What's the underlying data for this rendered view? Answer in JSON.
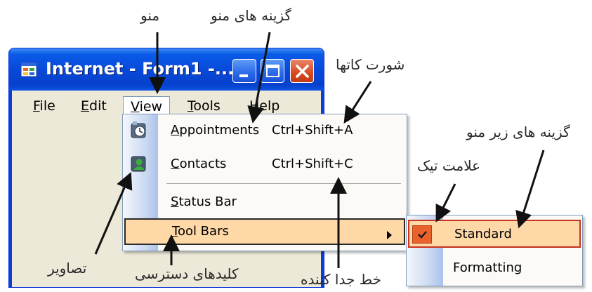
{
  "window": {
    "title": "Internet - Form1 -..."
  },
  "menubar": {
    "items": [
      {
        "label": "File",
        "mnemonic": "F",
        "rest": "ile"
      },
      {
        "label": "Edit",
        "mnemonic": "E",
        "rest": "dit"
      },
      {
        "label": "View",
        "mnemonic": "V",
        "rest": "iew"
      },
      {
        "label": "Tools",
        "mnemonic": "T",
        "rest": "ools"
      },
      {
        "label": "Help",
        "mnemonic": "H",
        "rest": "elp"
      }
    ],
    "open_menu": "View"
  },
  "view_menu": {
    "items": [
      {
        "label": "Appointments",
        "mnemonic": "A",
        "rest": "ppointments",
        "shortcut": "Ctrl+Shift+A",
        "icon": "appointments-icon"
      },
      {
        "label": "Contacts",
        "mnemonic": "C",
        "rest": "ontacts",
        "shortcut": "Ctrl+Shift+C",
        "icon": "contacts-icon"
      },
      {
        "label": "Status Bar",
        "mnemonic": "S",
        "rest": "tatus Bar"
      },
      {
        "label": "Tool Bars",
        "mnemonic": "T",
        "rest": "ool Bars",
        "has_submenu": true,
        "highlighted": true
      }
    ]
  },
  "toolbars_submenu": {
    "items": [
      {
        "label": "Standard",
        "checked": true,
        "highlighted": true
      },
      {
        "label": "Formatting",
        "checked": false
      }
    ]
  },
  "annotations": {
    "menu": "منو",
    "menu_items": "گزینه های منو",
    "shortcuts": "شورت کاتها",
    "submenu_items": "گزینه های زیر منو",
    "check_mark": "علامت تیک",
    "images": "تصاویر",
    "access_keys": "کلیدهای دسترسی",
    "separator": "خط جدا کننده"
  },
  "colors": {
    "titlebar": "#0a5ae8",
    "client_bg": "#ece9d8",
    "highlight_bg": "#ffd8a8",
    "check_bg": "#e9622e",
    "close_button": "#d9481f"
  }
}
